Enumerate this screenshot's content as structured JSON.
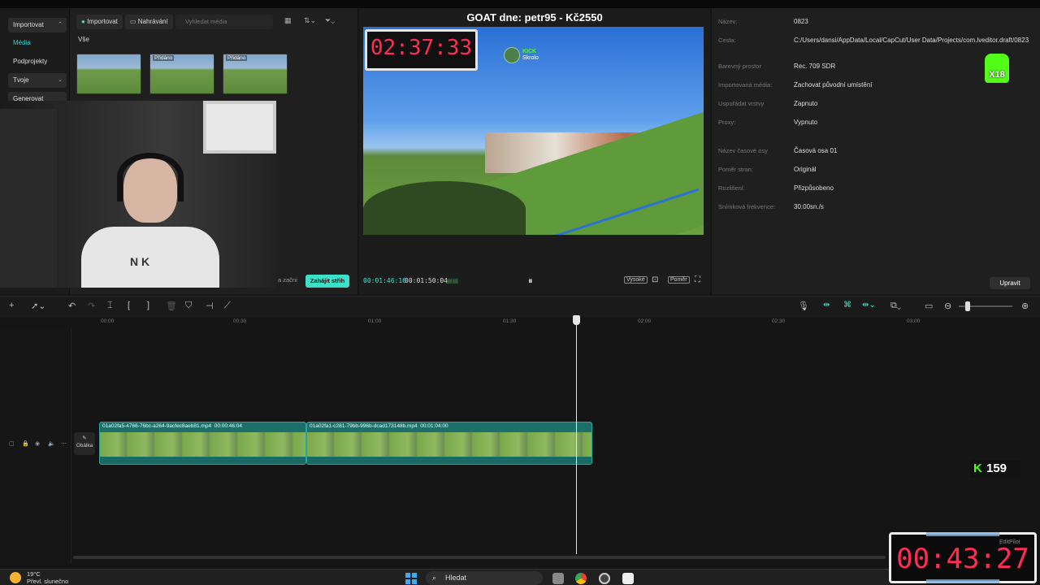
{
  "media_panel": {
    "nav": [
      {
        "label": "Importovat",
        "dropdown": true
      },
      {
        "label": "Média",
        "active": true
      },
      {
        "label": "Podprojekty"
      },
      {
        "label": "Tvoje",
        "dropdown": true
      },
      {
        "label": "Generovat"
      }
    ],
    "import_button": "Importovat",
    "recording_button": "Nahrávání",
    "search_placeholder": "Vyhledat média",
    "section_title": "Vše",
    "thumbnails": [
      {
        "badge": ""
      },
      {
        "badge": "Přidáno"
      },
      {
        "badge": "Přidáno"
      }
    ],
    "start_label": "a začni",
    "start_button": "Zahájit střih"
  },
  "player": {
    "title": "GOAT dne: petr95 - Kč2550",
    "overlay_timer": "02:37:33",
    "kick_label": "KICK",
    "kick_sub": "Skrolo",
    "current_time": "00:01:46:16",
    "total_time": "00:01:50:04",
    "quality_button": "Vysoké",
    "ratio_button": "Poměr"
  },
  "properties": {
    "rows": [
      {
        "label": "Název:",
        "value": "0823"
      },
      {
        "label": "Cesta:",
        "value": "C:/Users/dansi/AppData/Local/CapCut/User Data/Projects/com.lveditor.draft/0823"
      },
      {
        "label": "Barevný prostor",
        "value": "Rec. 709 SDR"
      },
      {
        "label": "Importovaná média:",
        "value": "Zachovat původní umístění"
      },
      {
        "label": "Uspořádat vrstvy",
        "value": "Zapnuto"
      },
      {
        "label": "Proxy:",
        "value": "Vypnuto"
      },
      {
        "label": "Název časové osy",
        "value": "Časová osa 01"
      },
      {
        "label": "Poměr stran:",
        "value": "Originál"
      },
      {
        "label": "Rozlišení:",
        "value": "Přizpůsobeno"
      },
      {
        "label": "Snímková frekvence:",
        "value": "30.00sn./s"
      }
    ],
    "edit_button": "Upravit",
    "badge": "X18"
  },
  "timeline": {
    "ticks": [
      "00:00",
      "00:30",
      "01:00",
      "01:30",
      "02:00",
      "02:30",
      "03:00"
    ],
    "cover_label": "Obálka",
    "clips": [
      {
        "name": "01a02fa5-4766-76bc-a264-9acfec8aeb81.mp4",
        "duration": "00:00:46:04"
      },
      {
        "name": "01a02fa1-c281-79bb-996b-dcad173148b.mp4",
        "duration": "00:01:04:00"
      }
    ]
  },
  "overlays": {
    "kick_count": "159",
    "big_timer": "00:43:27",
    "editpilot": "EditPilot"
  },
  "taskbar": {
    "temperature": "19°C",
    "weather": "Převl. slunečno",
    "search": "Hledat"
  },
  "colors": {
    "accent": "#3ce0c8",
    "timer": "#ff2d55",
    "kick": "#53fc18",
    "clip": "#1d6f6a"
  }
}
